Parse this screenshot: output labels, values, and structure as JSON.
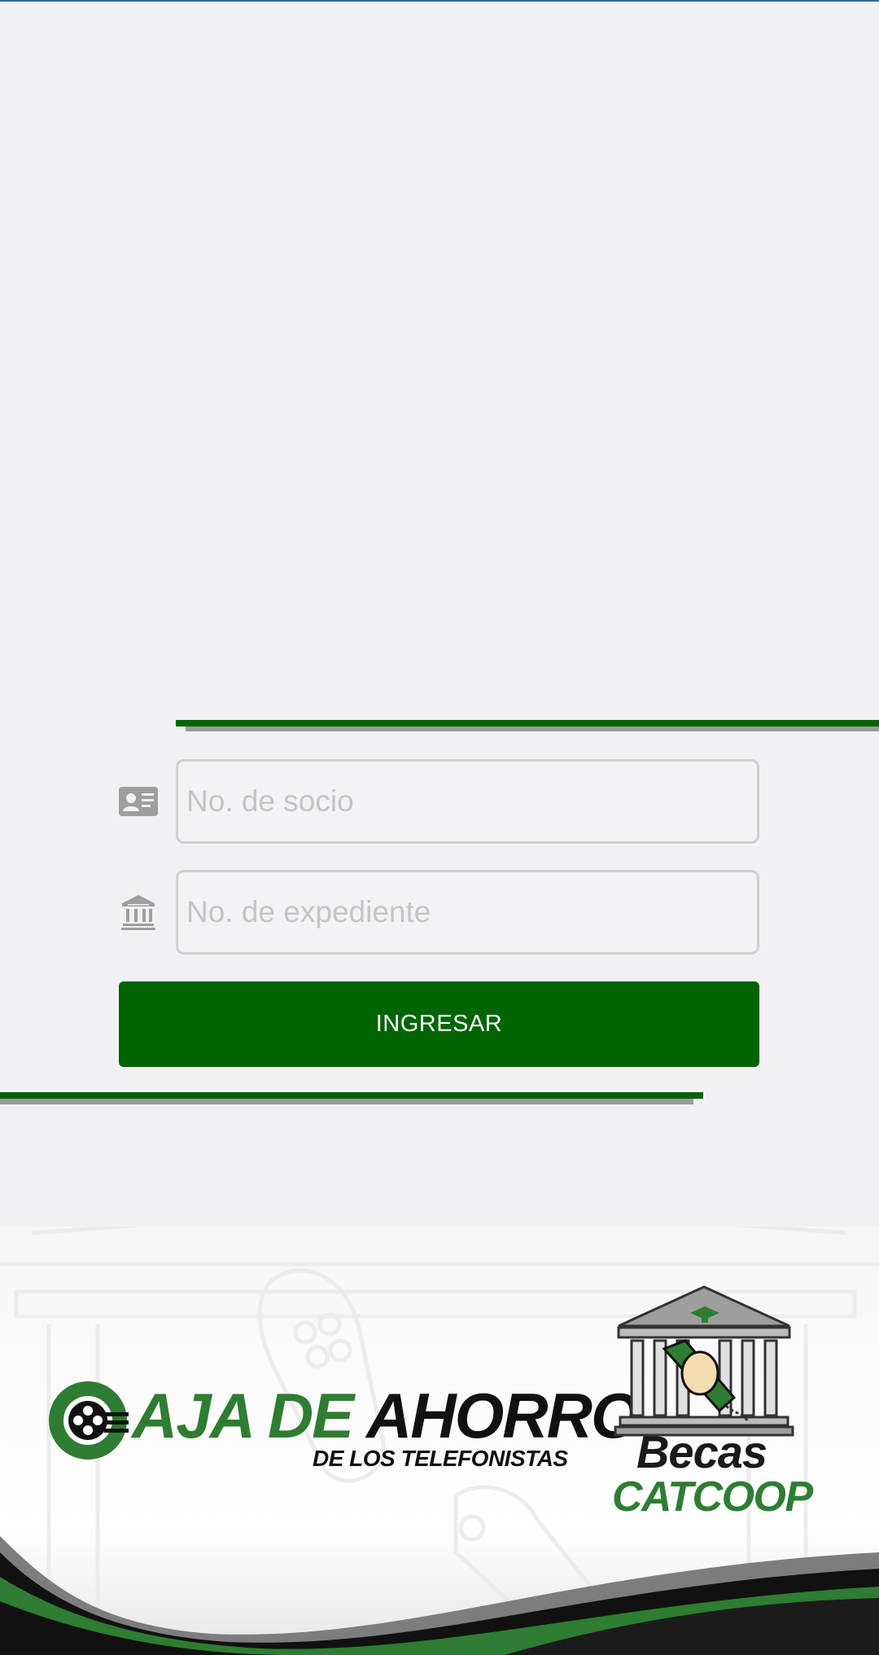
{
  "form": {
    "socio_placeholder": "No. de socio",
    "socio_value": "",
    "expediente_placeholder": "No. de expediente",
    "expediente_value": "",
    "submit_label": "INGRESAR"
  },
  "icons": {
    "socio": "id-card-icon",
    "expediente": "bank-building-icon"
  },
  "footer": {
    "caja_logo": {
      "part_green": "AJA DE ",
      "part_black": "AHORRO",
      "subtitle": "DE LOS TELEFONISTAS"
    },
    "becas_logo": {
      "line1": "Becas",
      "line2": "CATCOOP"
    }
  },
  "colors": {
    "accent_green": "#006400",
    "logo_green": "#2e7d32",
    "background": "#f1f1f5",
    "input_border": "#cfcfcf",
    "placeholder": "#c4c4c4"
  }
}
